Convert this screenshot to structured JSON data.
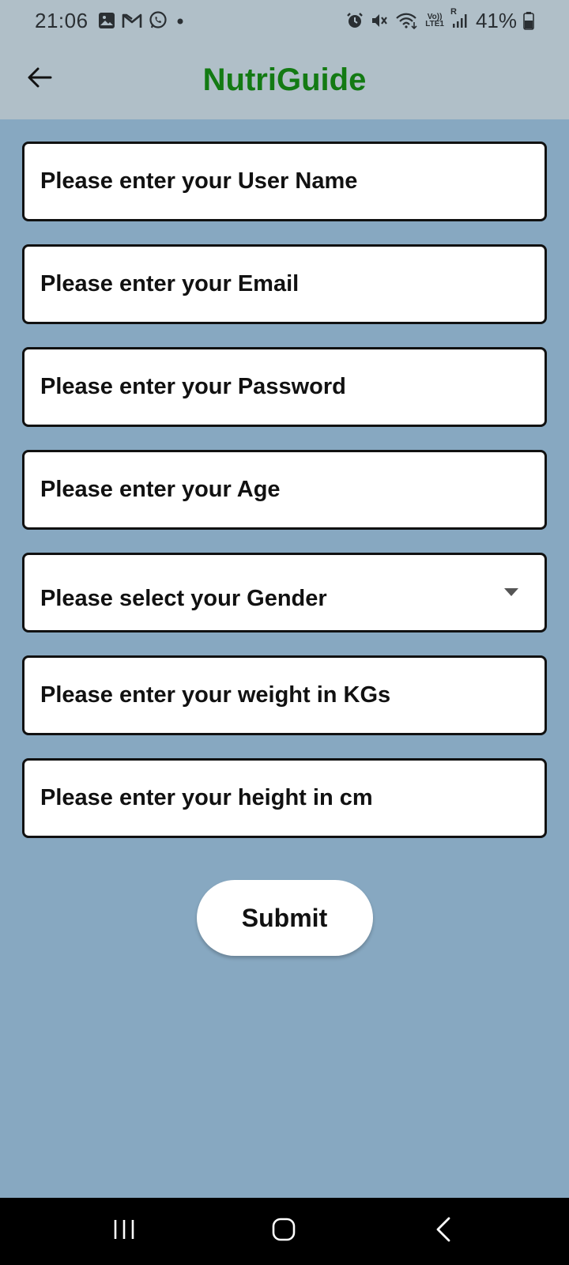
{
  "status_bar": {
    "time": "21:06",
    "battery_percent": "41%",
    "left_icons": [
      "gallery-icon",
      "gmail-icon",
      "whatsapp-icon",
      "notification-dot-icon"
    ],
    "right_icons": [
      "alarm-icon",
      "mute-icon",
      "wifi-icon",
      "volte-icon",
      "signal-icon",
      "battery-icon"
    ],
    "volte_label_top": "Vo))",
    "volte_label_bottom": "LTE1",
    "roaming_label": "R"
  },
  "app_bar": {
    "title": "NutriGuide",
    "title_color": "#137a13",
    "back_icon": "arrow-left-icon"
  },
  "form": {
    "username_placeholder": "Please enter your User Name",
    "email_placeholder": "Please enter your Email",
    "password_placeholder": "Please enter your Password",
    "age_placeholder": "Please enter your Age",
    "gender_label": "Please select your Gender",
    "weight_placeholder": "Please enter your weight in KGs",
    "height_placeholder": "Please enter your height in cm",
    "submit_label": "Submit"
  },
  "nav_bar": {
    "recents_icon": "recents-icon",
    "home_icon": "home-icon",
    "back_icon": "back-chevron-icon"
  },
  "colors": {
    "background": "#87a8c1",
    "app_bar": "#b0bfc8",
    "accent": "#137a13"
  }
}
